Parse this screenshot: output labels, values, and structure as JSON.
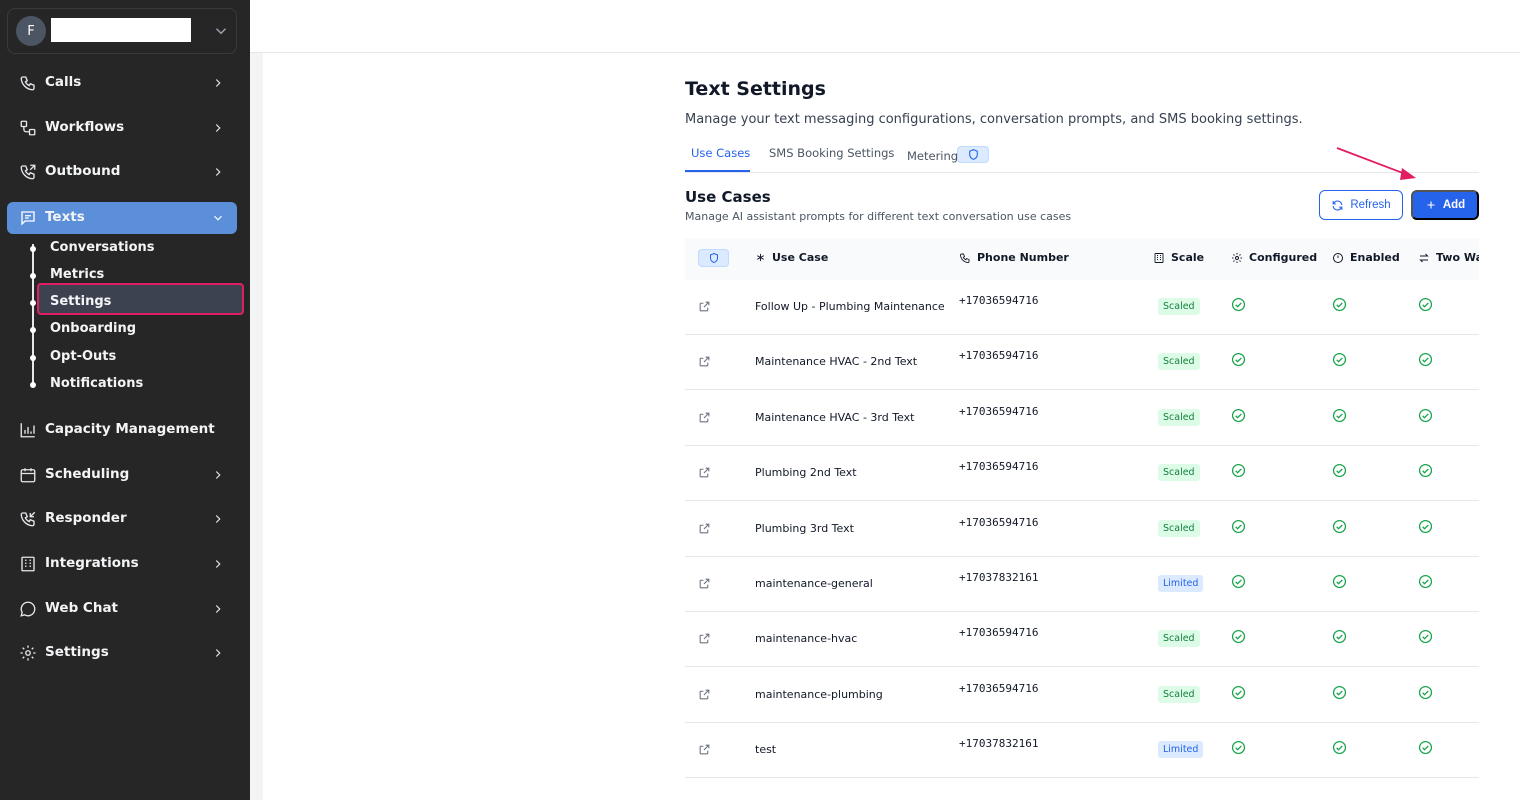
{
  "account": {
    "initial": "F"
  },
  "sidebar": {
    "items": [
      {
        "label": "Calls",
        "icon": "phone-icon"
      },
      {
        "label": "Workflows",
        "icon": "workflow-icon"
      },
      {
        "label": "Outbound",
        "icon": "phone-outgoing-icon"
      },
      {
        "label": "Texts",
        "icon": "message-icon"
      },
      {
        "label": "Capacity Management",
        "icon": "bar-chart-icon"
      },
      {
        "label": "Scheduling",
        "icon": "calendar-icon"
      },
      {
        "label": "Responder",
        "icon": "phone-incoming-icon"
      },
      {
        "label": "Integrations",
        "icon": "building-icon"
      },
      {
        "label": "Web Chat",
        "icon": "chat-bubble-icon"
      },
      {
        "label": "Settings",
        "icon": "gear-icon"
      }
    ],
    "texts_sub": [
      "Conversations",
      "Metrics",
      "Settings",
      "Onboarding",
      "Opt-Outs",
      "Notifications"
    ]
  },
  "page": {
    "title": "Text Settings",
    "subtitle": "Manage your text messaging configurations, conversation prompts, and SMS booking settings."
  },
  "tabs": [
    "Use Cases",
    "SMS Booking Settings",
    "Metering"
  ],
  "section": {
    "title": "Use Cases",
    "subtitle": "Manage AI assistant prompts for different text conversation use cases",
    "refresh_label": "Refresh",
    "add_label": "Add"
  },
  "table": {
    "headers": [
      "Use Case",
      "Phone Number",
      "Scale",
      "Configured",
      "Enabled",
      "Two Wa"
    ],
    "rows": [
      {
        "use_case": "Follow Up - Plumbing Maintenance",
        "phone": "+17036594716",
        "scale": "Scaled"
      },
      {
        "use_case": "Maintenance HVAC - 2nd Text",
        "phone": "+17036594716",
        "scale": "Scaled"
      },
      {
        "use_case": "Maintenance HVAC - 3rd Text",
        "phone": "+17036594716",
        "scale": "Scaled"
      },
      {
        "use_case": "Plumbing 2nd Text",
        "phone": "+17036594716",
        "scale": "Scaled"
      },
      {
        "use_case": "Plumbing 3rd Text",
        "phone": "+17036594716",
        "scale": "Scaled"
      },
      {
        "use_case": "maintenance-general",
        "phone": "+17037832161",
        "scale": "Limited"
      },
      {
        "use_case": "maintenance-hvac",
        "phone": "+17036594716",
        "scale": "Scaled"
      },
      {
        "use_case": "maintenance-plumbing",
        "phone": "+17036594716",
        "scale": "Scaled"
      },
      {
        "use_case": "test",
        "phone": "+17037832161",
        "scale": "Limited"
      }
    ]
  },
  "colors": {
    "accent": "#2563eb",
    "sidebar_bg": "#262626",
    "active_nav": "#5b8fd9",
    "success": "#16a34a",
    "highlight_border": "#e11d63"
  }
}
